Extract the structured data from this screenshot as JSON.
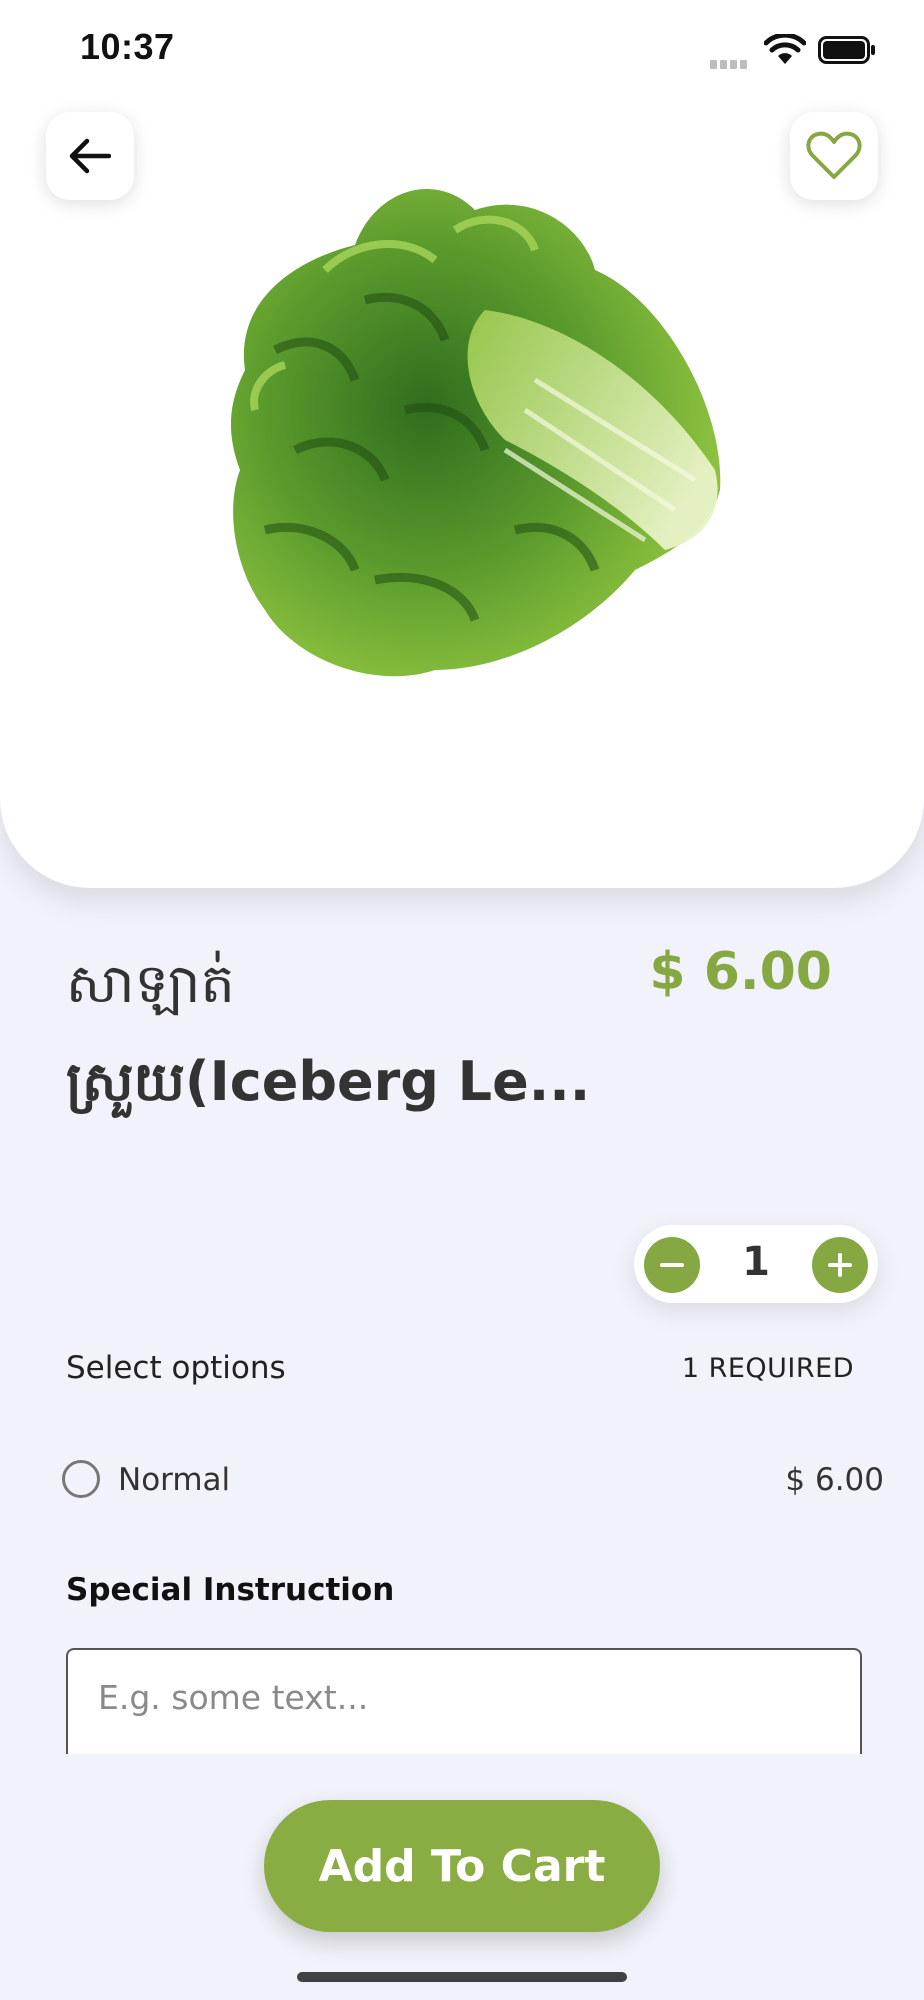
{
  "status_bar": {
    "time": "10:37"
  },
  "product": {
    "name_line1": "សាឡាត់",
    "name_line2": "ស្រួយ(Iceberg Le...",
    "price": "$ 6.00",
    "image_icon": "lettuce-image"
  },
  "quantity": {
    "value": "1"
  },
  "options": {
    "label": "Select options",
    "required": "1 REQUIRED",
    "items": [
      {
        "name": "Normal",
        "price": "$ 6.00",
        "selected": false
      }
    ]
  },
  "special_instruction": {
    "title": "Special Instruction",
    "placeholder": "E.g. some text...",
    "value": ""
  },
  "cart_button": {
    "label": "Add To Cart"
  },
  "colors": {
    "accent": "#86a843",
    "background": "#f2f3fa"
  }
}
